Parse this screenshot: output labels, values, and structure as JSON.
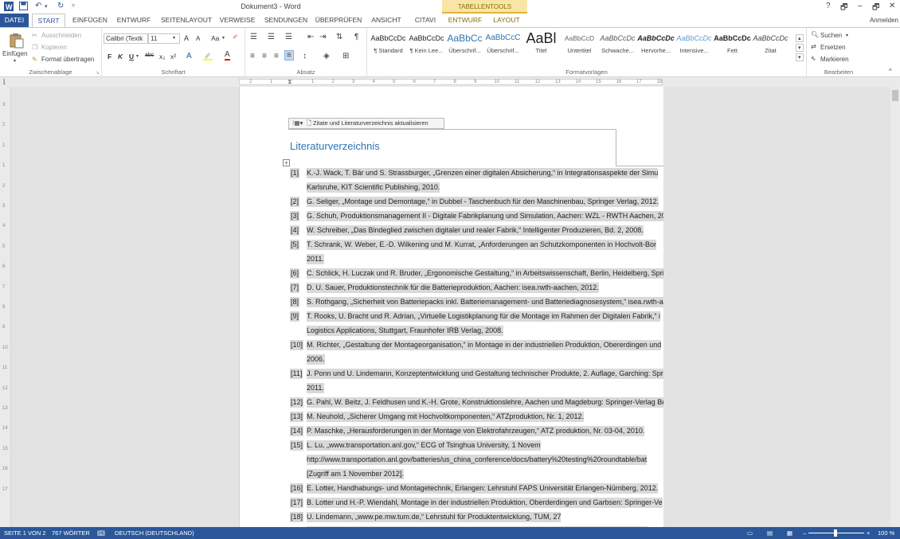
{
  "window": {
    "title": "Dokument3 - Word",
    "contextual_header": "TABELLENTOOLS",
    "help": "?",
    "restore": "🗗",
    "minimize": "–",
    "maximize": "🗗",
    "close": "✕",
    "signin": "Anmelden"
  },
  "tabs": {
    "datei": "DATEI",
    "start": "START",
    "einfuegen": "EINFÜGEN",
    "entwurf": "ENTWURF",
    "seitenlayout": "SEITENLAYOUT",
    "verweise": "VERWEISE",
    "sendungen": "SENDUNGEN",
    "ueberpruefen": "ÜBERPRÜFEN",
    "ansicht": "ANSICHT",
    "citavi": "CITAVI",
    "tt_entwurf": "ENTWURF",
    "tt_layout": "LAYOUT"
  },
  "ribbon": {
    "clipboard": {
      "paste": "Einfügen",
      "cut": "Ausschneiden",
      "copy": "Kopieren",
      "format_painter": "Format übertragen",
      "label": "Zwischenablage"
    },
    "font": {
      "family": "Calibri (Textk",
      "size": "11",
      "grow": "A",
      "shrink": "A",
      "case": "Aa",
      "bold": "F",
      "italic": "K",
      "underline": "U",
      "strike": "abc",
      "sub": "x₂",
      "sup": "x²",
      "label": "Schriftart"
    },
    "paragraph": {
      "label": "Absatz"
    },
    "styles": {
      "label": "Formatvorlagen",
      "items": [
        {
          "preview": "AaBbCcDc",
          "name": "¶ Standard"
        },
        {
          "preview": "AaBbCcDc",
          "name": "¶ Kein Lee..."
        },
        {
          "preview": "AaBbCc",
          "name": "Überschrif..."
        },
        {
          "preview": "AaBbCcC",
          "name": "Überschrif..."
        },
        {
          "preview": "AaBl",
          "name": "Titel"
        },
        {
          "preview": "AaBbCcD",
          "name": "Untertitel"
        },
        {
          "preview": "AaBbCcDc",
          "name": "Schwache..."
        },
        {
          "preview": "AaBbCcDc",
          "name": "Hervorhe..."
        },
        {
          "preview": "AaBbCcDc",
          "name": "Intensive..."
        },
        {
          "preview": "AaBbCcDc",
          "name": "Fett"
        },
        {
          "preview": "AaBbCcDc",
          "name": "Zitat"
        }
      ]
    },
    "editing": {
      "search": "Suchen",
      "replace": "Ersetzen",
      "select": "Markieren",
      "label": "Bearbeiten"
    }
  },
  "ruler": {
    "numbers": [
      "2",
      "1",
      "1",
      "2",
      "3",
      "4",
      "5",
      "6",
      "7",
      "8",
      "9",
      "10",
      "11",
      "12",
      "13",
      "14",
      "15",
      "16",
      "17",
      "18"
    ]
  },
  "vruler": {
    "numbers": [
      "3",
      "2",
      "1",
      "1",
      "2",
      "3",
      "4",
      "5",
      "6",
      "7",
      "8",
      "9",
      "10",
      "11",
      "12",
      "13",
      "14",
      "15",
      "16",
      "17"
    ]
  },
  "document": {
    "citavi_toolbar": "Zitate und Literaturverzeichnis aktualisieren",
    "table_handle": "+",
    "heading": "Literaturverzeichnis",
    "references": [
      {
        "num": "[1]",
        "lines": [
          "K.-J. Wack, T. Bär und S. Strassburger, „Grenzen einer digitalen Absicherung,“ in Integrationsaspekte der Simu",
          "Karlsruhe, KIT Scientific Publishing, 2010."
        ]
      },
      {
        "num": "[2]",
        "lines": [
          "G. Seliger, „Montage und Demontage,“ in Dubbel - Taschenbuch für den Maschinenbau, Springer Verlag, 2012."
        ]
      },
      {
        "num": "[3]",
        "lines": [
          "G. Schuh, Produktionsmanagement II - Digitale Fabrikplanung und Simulation, Aachen: WZL - RWTH Aachen, 201"
        ]
      },
      {
        "num": "[4]",
        "lines": [
          "W. Schreiber, „Das Bindeglied zwischen digitaler und realer Fabrik,“ Intelligenter Produzieren, Bd. 2, 2008."
        ]
      },
      {
        "num": "[5]",
        "lines": [
          "T. Schrank, W. Weber, E.-D. Wilkening und M. Kurrat, „Anforderungen an Schutzkomponenten in Hochvolt-Bor",
          "2011."
        ]
      },
      {
        "num": "[6]",
        "lines": [
          "C. Schlick, H. Luczak und R. Bruder, „Ergonomische Gestaltung,“ in Arbeitswissenschaft, Berlin, Heidelberg, Sprin"
        ]
      },
      {
        "num": "[7]",
        "lines": [
          "D. U. Sauer, Produktionstechnik für die Batterieproduktion, Aachen: isea.rwth-aachen, 2012."
        ]
      },
      {
        "num": "[8]",
        "lines": [
          "S. Rothgang, „Sicherheit von Batteriepacks inkl. Batteriemanagement- und Batteriediagnosesystem,“ isea.rwth-a"
        ]
      },
      {
        "num": "[9]",
        "lines": [
          "T. Rooks, U. Bracht und R. Adrian, „Virtuelle Logistikplanung für die Montage im Rahmen der Digitalen Fabrik,“ i",
          "Logistics Applications, Stuttgart, Fraunhofer IRB Verlag, 2008."
        ]
      },
      {
        "num": "[10]",
        "lines": [
          "M. Richter, „Gestaltung der Montageorganisation,“ in Montage in der industriellen Produktion, Obererdingen und",
          "2006."
        ]
      },
      {
        "num": "[11]",
        "lines": [
          "J. Ponn und U. Lindemann, Konzeptentwicklung und Gestaltung technischer Produkte, 2. Auflage, Garching: Sprin",
          "2011."
        ]
      },
      {
        "num": "[12]",
        "lines": [
          "G. Pahl, W. Beitz, J. Feldhusen und K.-H. Grote, Konstruktionslehre, Aachen und Magdeburg: Springer-Verlag Ber"
        ]
      },
      {
        "num": "[13]",
        "lines": [
          "M. Neuhold, „Sicherer Umgang mit Hochvoltkomponenten,“ ATZproduktion, Nr. 1, 2012."
        ]
      },
      {
        "num": "[14]",
        "lines": [
          "P. Maschke, „Herausforderungen in der Montage von Elektrofahrzeugen,“ ATZ produktion, Nr. 03-04, 2010."
        ]
      },
      {
        "num": "[15]",
        "lines": [
          "L.       Lu,       „www.transportation.anl.gov,“       ECG       of       Tsinghua       University,       1       Novem",
          "http://www.transportation.anl.gov/batteries/us_china_conference/docs/battery%20testing%20roundtable/bat",
          "[Zugriff am 1 November 2012]."
        ]
      },
      {
        "num": "[16]",
        "lines": [
          "E. Lotter, Handhabungs- und Montagetechnik, Erlangen: Lehrstuhl FAPS Universität Erlangen-Nürnberg, 2012."
        ]
      },
      {
        "num": "[17]",
        "lines": [
          "B. Lotter und H.-P. Wiendahl, Montage in der industriellen Produktion, Oberderdingen und Garbsen: Springer-Ve"
        ]
      },
      {
        "num": "[18]",
        "lines": [
          "U.       Lindemann,       „www.pe.mw.tum.de,“       Lehrstuhl       für       Produktentwicklung,       TUM,       27",
          "http://www.pe.mw.tum.de/studium/vorlesungen/produktentwicklung-und-konstruktion-1/puk_ss_2012_vo_11"
        ]
      }
    ]
  },
  "status": {
    "page": "SEITE 1 VON 2",
    "words": "767 WÖRTER",
    "language": "DEUTSCH (DEUTSCHLAND)",
    "zoom_minus": "–",
    "zoom_plus": "+",
    "zoom": "100 %"
  },
  "colors": {
    "accent": "#2b579a",
    "heading": "#2e74b5",
    "highlight": "#d9d9d9",
    "tabletools": "#f9e6a6"
  }
}
